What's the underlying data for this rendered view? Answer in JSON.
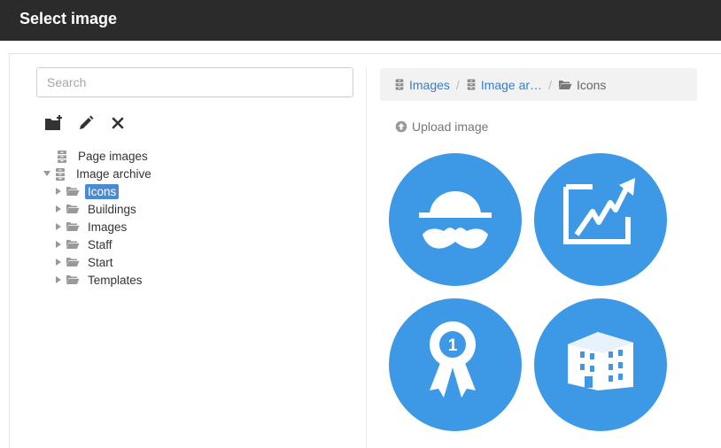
{
  "dialog": {
    "title": "Select image"
  },
  "search": {
    "placeholder": "Search"
  },
  "toolbar": [
    {
      "icon": "new-folder-icon"
    },
    {
      "icon": "pencil-icon"
    },
    {
      "icon": "close-icon"
    }
  ],
  "tree": {
    "roots": [
      {
        "label": "Page images",
        "icon": "archive-icon",
        "expanded": false
      },
      {
        "label": "Image archive",
        "icon": "archive-icon",
        "expanded": true
      }
    ],
    "folders": [
      {
        "label": "Icons",
        "selected": true
      },
      {
        "label": "Buildings",
        "selected": false
      },
      {
        "label": "Images",
        "selected": false
      },
      {
        "label": "Staff",
        "selected": false
      },
      {
        "label": "Start",
        "selected": false
      },
      {
        "label": "Templates",
        "selected": false
      }
    ]
  },
  "breadcrumb": {
    "items": [
      {
        "label": "Images",
        "icon": "archive-icon"
      },
      {
        "label": "Image ar…",
        "icon": "archive-icon"
      },
      {
        "label": "Icons",
        "icon": "folder-open-icon"
      }
    ]
  },
  "upload": {
    "label": "Upload image",
    "icon": "upload-icon"
  },
  "thumbnails": [
    {
      "icon": "hat-mustache-icon"
    },
    {
      "icon": "growth-chart-icon"
    },
    {
      "icon": "award-ribbon-icon",
      "badge": "1"
    },
    {
      "icon": "building-icon"
    }
  ],
  "colors": {
    "topbar": "#2b2b2b",
    "accent": "#3d98e5",
    "selection": "#4a8ad4",
    "link": "#3a7dc4"
  }
}
